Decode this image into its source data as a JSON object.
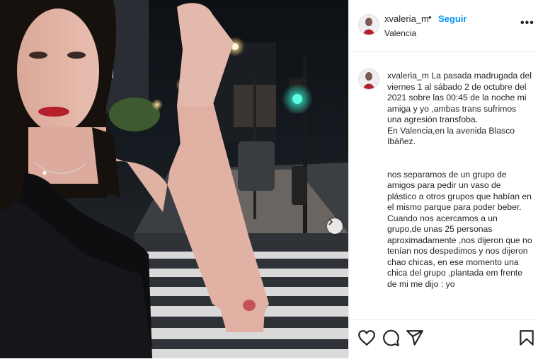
{
  "post": {
    "username": "xvaleria_m",
    "separator": "•",
    "follow_label": "Seguir",
    "location": "Valencia",
    "more_icon": "more-horizontal-icon",
    "next_icon": "chevron-right-icon"
  },
  "caption": {
    "username": "xvaleria_m",
    "line1": "La pasada madrugada del viernes 1 al sábado 2 de octubre del 2021 sobre las 00:45 de la noche mi amiga y yo ,ambas trans sufrimos una agresión transfoba.",
    "line2": "En Valencia,en la avenida Blasco Ibáñez.",
    "line3": "nos separamos de un grupo de amigos para pedir un vaso de plástico a otros grupos que habían en el mismo parque para poder beber. Cuando nos acercamos a un grupo,de unas 25 personas aproximadamente ,nos dijeron que no tenían nos despedimos y nos dijeron chao chicas, en ese momento una chica del grupo ,plantada em frente de mi me dijo : yo"
  },
  "actions": {
    "like_icon": "heart-icon",
    "comment_icon": "comment-icon",
    "share_icon": "share-icon",
    "save_icon": "bookmark-icon"
  },
  "colors": {
    "accent": "#0095f6",
    "text": "#262626",
    "border": "#efefef",
    "traffic_light": "#17e0c4"
  }
}
